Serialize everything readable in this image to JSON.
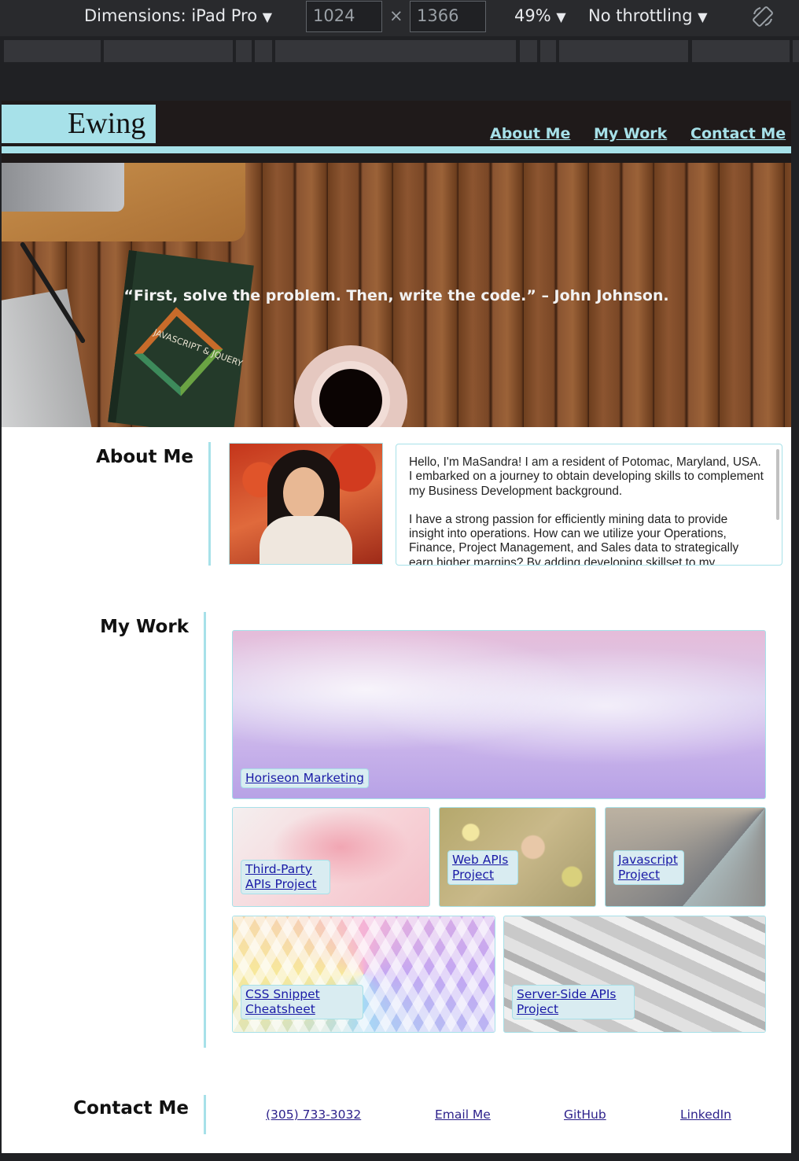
{
  "devtools": {
    "dimensions_label": "Dimensions: iPad Pro",
    "width_value": "1024",
    "times": "×",
    "height_value": "1366",
    "zoom": "49%",
    "throttling": "No throttling",
    "dropdown_glyph": "▼"
  },
  "site": {
    "logo": "Ewing",
    "nav": {
      "about": "About Me",
      "work": "My Work",
      "contact": "Contact Me"
    },
    "hero_quote": "“First, solve the problem. Then, write the code.” – John Johnson.",
    "hero_book_title": "JAVASCRIPT & JQUERY",
    "about": {
      "title": "About Me",
      "bio_paragraphs": [
        "Hello, I'm MaSandra! I am a resident of Potomac, Maryland, USA. I embarked on a journey to obtain developing skills to complement my Business Development background.",
        "I have a strong passion for efficiently mining data to provide insight into operations. How can we utilize your Operations, Finance, Project Management, and Sales data to strategically earn higher margins? By adding developing skillset to my"
      ]
    },
    "work": {
      "title": "My Work",
      "projects": [
        {
          "label": "Horiseon Marketing"
        },
        {
          "label": "Third-Party APIs Project"
        },
        {
          "label": "Web APIs Project"
        },
        {
          "label": "Javascript Project"
        },
        {
          "label": "CSS Snippet Cheatsheet"
        },
        {
          "label": "Server-Side APIs Project"
        }
      ]
    },
    "contact": {
      "title": "Contact Me",
      "phone": "(305) 733-3032",
      "email": "Email Me",
      "github": "GitHub",
      "linkedin": "LinkedIn"
    }
  },
  "colors": {
    "accent": "#a7e1e9",
    "header_bg": "#1f1a1a",
    "link": "#1a1aa6"
  }
}
